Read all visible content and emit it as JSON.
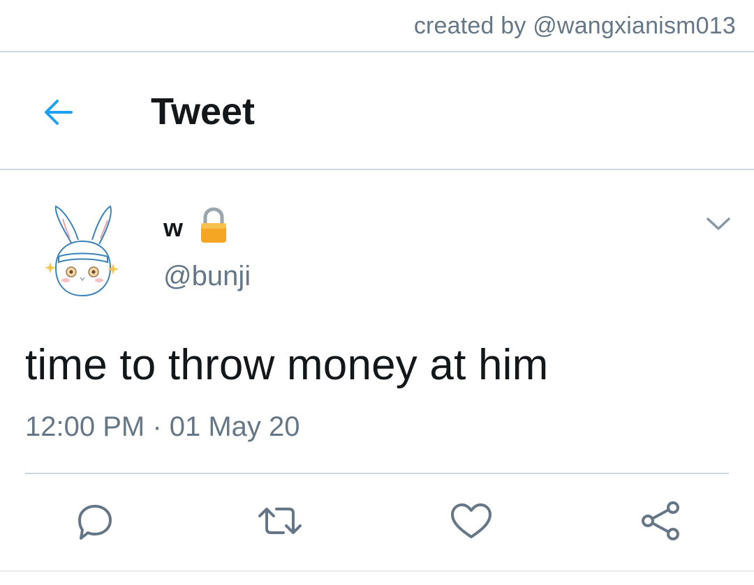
{
  "watermark": {
    "credit_text": "created by @wangxianism013"
  },
  "header": {
    "title": "Tweet",
    "back_icon": "arrow-left-icon",
    "accent_color": "#1da1f2"
  },
  "tweet": {
    "author": {
      "display_name": "w",
      "handle": "@bunji",
      "protected_icon": "lock-icon",
      "avatar": "bunny-avatar"
    },
    "text": "time to throw money at him",
    "timestamp": "12:00 PM · 01 May 20",
    "menu_icon": "chevron-down-icon"
  },
  "actions": [
    {
      "name": "reply",
      "icon": "speech-bubble-icon"
    },
    {
      "name": "retweet",
      "icon": "retweet-icon"
    },
    {
      "name": "like",
      "icon": "heart-icon"
    },
    {
      "name": "share",
      "icon": "share-icon"
    }
  ],
  "colors": {
    "text_primary": "#14171a",
    "text_secondary": "#657786",
    "icon_gray": "#657786",
    "divider": "#cfd7de",
    "lock_gold": "#f5a623"
  }
}
